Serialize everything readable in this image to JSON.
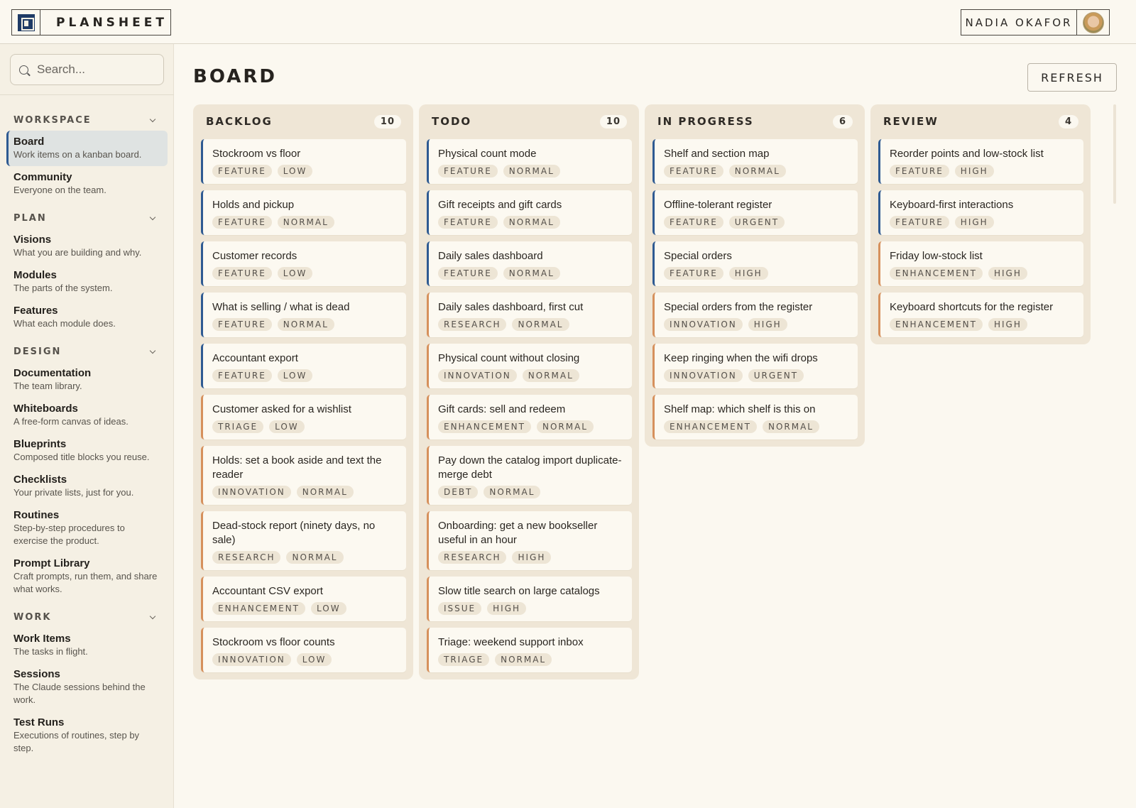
{
  "app": {
    "name": "PLANSHEET"
  },
  "user": {
    "name": "NADIA OKAFOR"
  },
  "search": {
    "placeholder": "Search..."
  },
  "sidebar": {
    "sections": [
      {
        "label": "WORKSPACE",
        "items": [
          {
            "title": "Board",
            "desc": "Work items on a kanban board.",
            "active": true
          },
          {
            "title": "Community",
            "desc": "Everyone on the team."
          }
        ]
      },
      {
        "label": "PLAN",
        "items": [
          {
            "title": "Visions",
            "desc": "What you are building and why."
          },
          {
            "title": "Modules",
            "desc": "The parts of the system."
          },
          {
            "title": "Features",
            "desc": "What each module does."
          }
        ]
      },
      {
        "label": "DESIGN",
        "items": [
          {
            "title": "Documentation",
            "desc": "The team library."
          },
          {
            "title": "Whiteboards",
            "desc": "A free-form canvas of ideas."
          },
          {
            "title": "Blueprints",
            "desc": "Composed title blocks you reuse."
          },
          {
            "title": "Checklists",
            "desc": "Your private lists, just for you."
          },
          {
            "title": "Routines",
            "desc": "Step-by-step procedures to exercise the product."
          },
          {
            "title": "Prompt Library",
            "desc": "Craft prompts, run them, and share what works."
          }
        ]
      },
      {
        "label": "WORK",
        "items": [
          {
            "title": "Work Items",
            "desc": "The tasks in flight."
          },
          {
            "title": "Sessions",
            "desc": "The Claude sessions behind the work."
          },
          {
            "title": "Test Runs",
            "desc": "Executions of routines, step by step."
          }
        ]
      }
    ]
  },
  "main": {
    "title": "BOARD",
    "refresh_label": "REFRESH"
  },
  "columns": [
    {
      "name": "BACKLOG",
      "count": "10",
      "cards": [
        {
          "title": "Stockroom vs floor",
          "tags": [
            "FEATURE",
            "LOW"
          ],
          "accent": "blue"
        },
        {
          "title": "Holds and pickup",
          "tags": [
            "FEATURE",
            "NORMAL"
          ],
          "accent": "blue"
        },
        {
          "title": "Customer records",
          "tags": [
            "FEATURE",
            "LOW"
          ],
          "accent": "blue"
        },
        {
          "title": "What is selling / what is dead",
          "tags": [
            "FEATURE",
            "NORMAL"
          ],
          "accent": "blue"
        },
        {
          "title": "Accountant export",
          "tags": [
            "FEATURE",
            "LOW"
          ],
          "accent": "blue"
        },
        {
          "title": "Customer asked for a wishlist",
          "tags": [
            "TRIAGE",
            "LOW"
          ],
          "accent": "orange"
        },
        {
          "title": "Holds: set a book aside and text the reader",
          "tags": [
            "INNOVATION",
            "NORMAL"
          ],
          "accent": "orange"
        },
        {
          "title": "Dead-stock report (ninety days, no sale)",
          "tags": [
            "RESEARCH",
            "NORMAL"
          ],
          "accent": "orange"
        },
        {
          "title": "Accountant CSV export",
          "tags": [
            "ENHANCEMENT",
            "LOW"
          ],
          "accent": "orange"
        },
        {
          "title": "Stockroom vs floor counts",
          "tags": [
            "INNOVATION",
            "LOW"
          ],
          "accent": "orange"
        }
      ]
    },
    {
      "name": "TODO",
      "count": "10",
      "cards": [
        {
          "title": "Physical count mode",
          "tags": [
            "FEATURE",
            "NORMAL"
          ],
          "accent": "blue"
        },
        {
          "title": "Gift receipts and gift cards",
          "tags": [
            "FEATURE",
            "NORMAL"
          ],
          "accent": "blue"
        },
        {
          "title": "Daily sales dashboard",
          "tags": [
            "FEATURE",
            "NORMAL"
          ],
          "accent": "blue"
        },
        {
          "title": "Daily sales dashboard, first cut",
          "tags": [
            "RESEARCH",
            "NORMAL"
          ],
          "accent": "orange"
        },
        {
          "title": "Physical count without closing",
          "tags": [
            "INNOVATION",
            "NORMAL"
          ],
          "accent": "orange"
        },
        {
          "title": "Gift cards: sell and redeem",
          "tags": [
            "ENHANCEMENT",
            "NORMAL"
          ],
          "accent": "orange"
        },
        {
          "title": "Pay down the catalog import duplicate-merge debt",
          "tags": [
            "DEBT",
            "NORMAL"
          ],
          "accent": "orange"
        },
        {
          "title": "Onboarding: get a new bookseller useful in an hour",
          "tags": [
            "RESEARCH",
            "HIGH"
          ],
          "accent": "orange"
        },
        {
          "title": "Slow title search on large catalogs",
          "tags": [
            "ISSUE",
            "HIGH"
          ],
          "accent": "orange"
        },
        {
          "title": "Triage: weekend support inbox",
          "tags": [
            "TRIAGE",
            "NORMAL"
          ],
          "accent": "orange"
        }
      ]
    },
    {
      "name": "IN PROGRESS",
      "count": "6",
      "cards": [
        {
          "title": "Shelf and section map",
          "tags": [
            "FEATURE",
            "NORMAL"
          ],
          "accent": "blue"
        },
        {
          "title": "Offline-tolerant register",
          "tags": [
            "FEATURE",
            "URGENT"
          ],
          "accent": "blue"
        },
        {
          "title": "Special orders",
          "tags": [
            "FEATURE",
            "HIGH"
          ],
          "accent": "blue"
        },
        {
          "title": "Special orders from the register",
          "tags": [
            "INNOVATION",
            "HIGH"
          ],
          "accent": "orange"
        },
        {
          "title": "Keep ringing when the wifi drops",
          "tags": [
            "INNOVATION",
            "URGENT"
          ],
          "accent": "orange"
        },
        {
          "title": "Shelf map: which shelf is this on",
          "tags": [
            "ENHANCEMENT",
            "NORMAL"
          ],
          "accent": "orange"
        }
      ]
    },
    {
      "name": "REVIEW",
      "count": "4",
      "cards": [
        {
          "title": "Reorder points and low-stock list",
          "tags": [
            "FEATURE",
            "HIGH"
          ],
          "accent": "blue"
        },
        {
          "title": "Keyboard-first interactions",
          "tags": [
            "FEATURE",
            "HIGH"
          ],
          "accent": "blue"
        },
        {
          "title": "Friday low-stock list",
          "tags": [
            "ENHANCEMENT",
            "HIGH"
          ],
          "accent": "orange"
        },
        {
          "title": "Keyboard shortcuts for the register",
          "tags": [
            "ENHANCEMENT",
            "HIGH"
          ],
          "accent": "orange"
        }
      ]
    }
  ]
}
